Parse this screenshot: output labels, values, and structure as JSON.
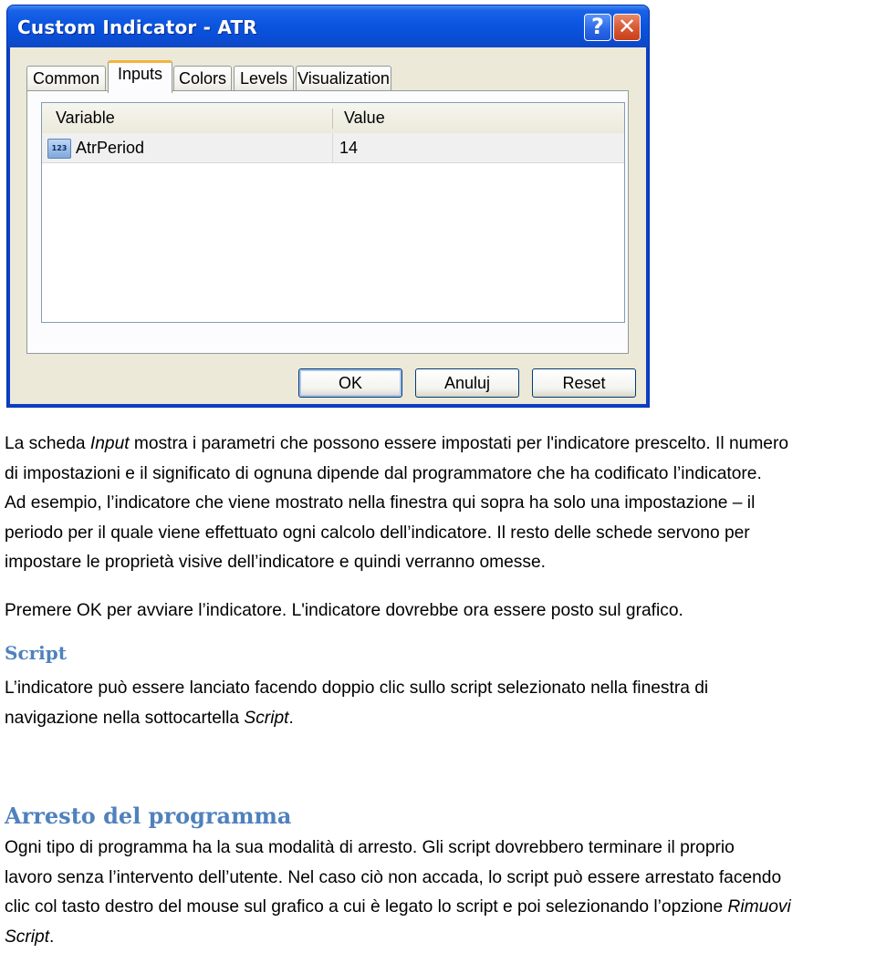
{
  "dialog": {
    "title": "Custom Indicator - ATR",
    "help_button": "?",
    "close_button": "✕",
    "tabs": [
      {
        "label": "Common",
        "active": false
      },
      {
        "label": "Inputs",
        "active": true
      },
      {
        "label": "Colors",
        "active": false
      },
      {
        "label": "Levels",
        "active": false
      },
      {
        "label": "Visualization",
        "active": false
      }
    ],
    "grid": {
      "columns": [
        "Variable",
        "Value"
      ],
      "rows": [
        {
          "icon": "integer-variable-icon",
          "icon_text": "123",
          "variable": "AtrPeriod",
          "value": "14"
        }
      ]
    },
    "buttons": {
      "ok": "OK",
      "cancel": "Anuluj",
      "reset": "Reset"
    }
  },
  "document": {
    "p1": {
      "l1a": "La scheda ",
      "l1b": "Input",
      "l1c": " mostra i parametri che possono essere impostati per l'indicatore prescelto. Il numero",
      "l2": "di impostazioni e il significato di ognuna dipende dal programmatore che ha codificato l’indicatore.",
      "l3": "Ad esempio, l’indicatore che viene mostrato nella finestra qui sopra ha solo una impostazione – il",
      "l4": "periodo per il quale viene effettuato ogni calcolo dell’indicatore. Il resto delle schede servono per",
      "l5": "impostare le proprietà visive dell’indicatore e quindi verranno omesse."
    },
    "p2": "Premere OK per avviare l’indicatore. L'indicatore dovrebbe ora essere posto sul grafico.",
    "heading_script": "Script",
    "p3": {
      "l1": "L’indicatore può essere lanciato facendo doppio clic sullo script selezionato nella finestra di",
      "l2a": "navigazione nella sottocartella ",
      "l2b": "Script",
      "l2c": "."
    },
    "heading_arresto": "Arresto del programma",
    "p4": {
      "l1": "Ogni tipo di programma ha la sua modalità di arresto. Gli script dovrebbero terminare il proprio",
      "l2": "lavoro senza l’intervento dell’utente. Nel caso ciò non accada, lo script può essere arrestato facendo",
      "l3a": "clic col tasto destro del mouse sul grafico a cui è legato lo script e poi selezionando l’opzione ",
      "l3b": "Rimuovi",
      "l4a": "Script",
      "l4b": "."
    },
    "heading_color": "#4f81bd"
  }
}
